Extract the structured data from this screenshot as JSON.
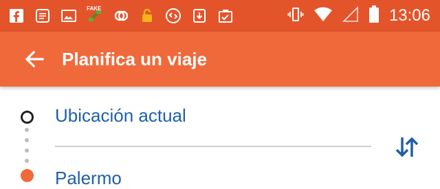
{
  "status_bar": {
    "time": "13:06",
    "icons": [
      "facebook-icon",
      "message-icon",
      "image-icon",
      "fake-gps-icon",
      "link-icon",
      "lock-icon",
      "shazam-icon",
      "download-icon",
      "clipboard-check-icon"
    ],
    "right_icons": [
      "vibrate-icon",
      "wifi-icon",
      "signal-icon",
      "battery-icon"
    ],
    "fake_label": "FAKE"
  },
  "app_bar": {
    "title": "Planifica un viaje"
  },
  "route": {
    "origin": "Ubicación actual",
    "destination": "Palermo"
  },
  "colors": {
    "status_bar": "#e4542a",
    "app_bar": "#f0693a",
    "link_text": "#1f5fa8",
    "swap_icon": "#1f5fa8"
  }
}
